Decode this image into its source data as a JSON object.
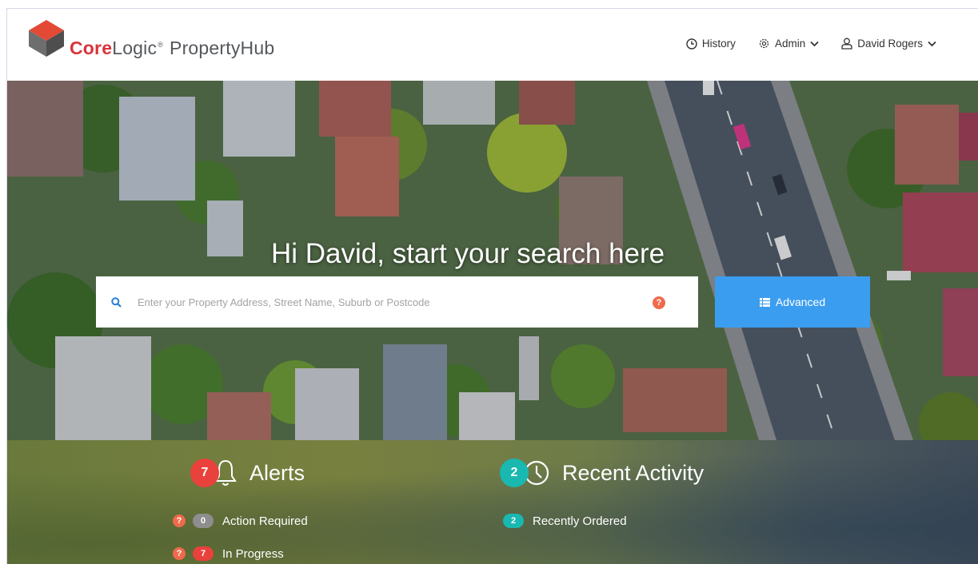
{
  "header": {
    "brand_core": "Core",
    "brand_logic": "Logic",
    "brand_reg": "®",
    "brand_product": "PropertyHub",
    "nav": [
      {
        "label": "History",
        "icon": "clock-icon"
      },
      {
        "label": "Admin",
        "icon": "gear-icon",
        "dropdown": true
      },
      {
        "label": "David Rogers",
        "icon": "user-icon",
        "dropdown": true
      }
    ]
  },
  "hero": {
    "greeting": "Hi David, start your search here",
    "search_placeholder": "Enter your Property Address, Street Name, Suburb or Postcode",
    "help_label": "?",
    "advanced_label": "Advanced"
  },
  "alerts": {
    "count": "7",
    "title": "Alerts",
    "items": [
      {
        "count": "0",
        "label": "Action Required",
        "color": "grey"
      },
      {
        "count": "7",
        "label": "In Progress",
        "color": "red"
      }
    ]
  },
  "activity": {
    "count": "2",
    "title": "Recent Activity",
    "items": [
      {
        "count": "2",
        "label": "Recently Ordered",
        "color": "teal"
      }
    ]
  },
  "colors": {
    "brand_red": "#d8343b",
    "accent_blue": "#3b9df0",
    "alert_red": "#e9413b",
    "teal": "#19b8b0",
    "help_orange": "#ef6a4c"
  }
}
